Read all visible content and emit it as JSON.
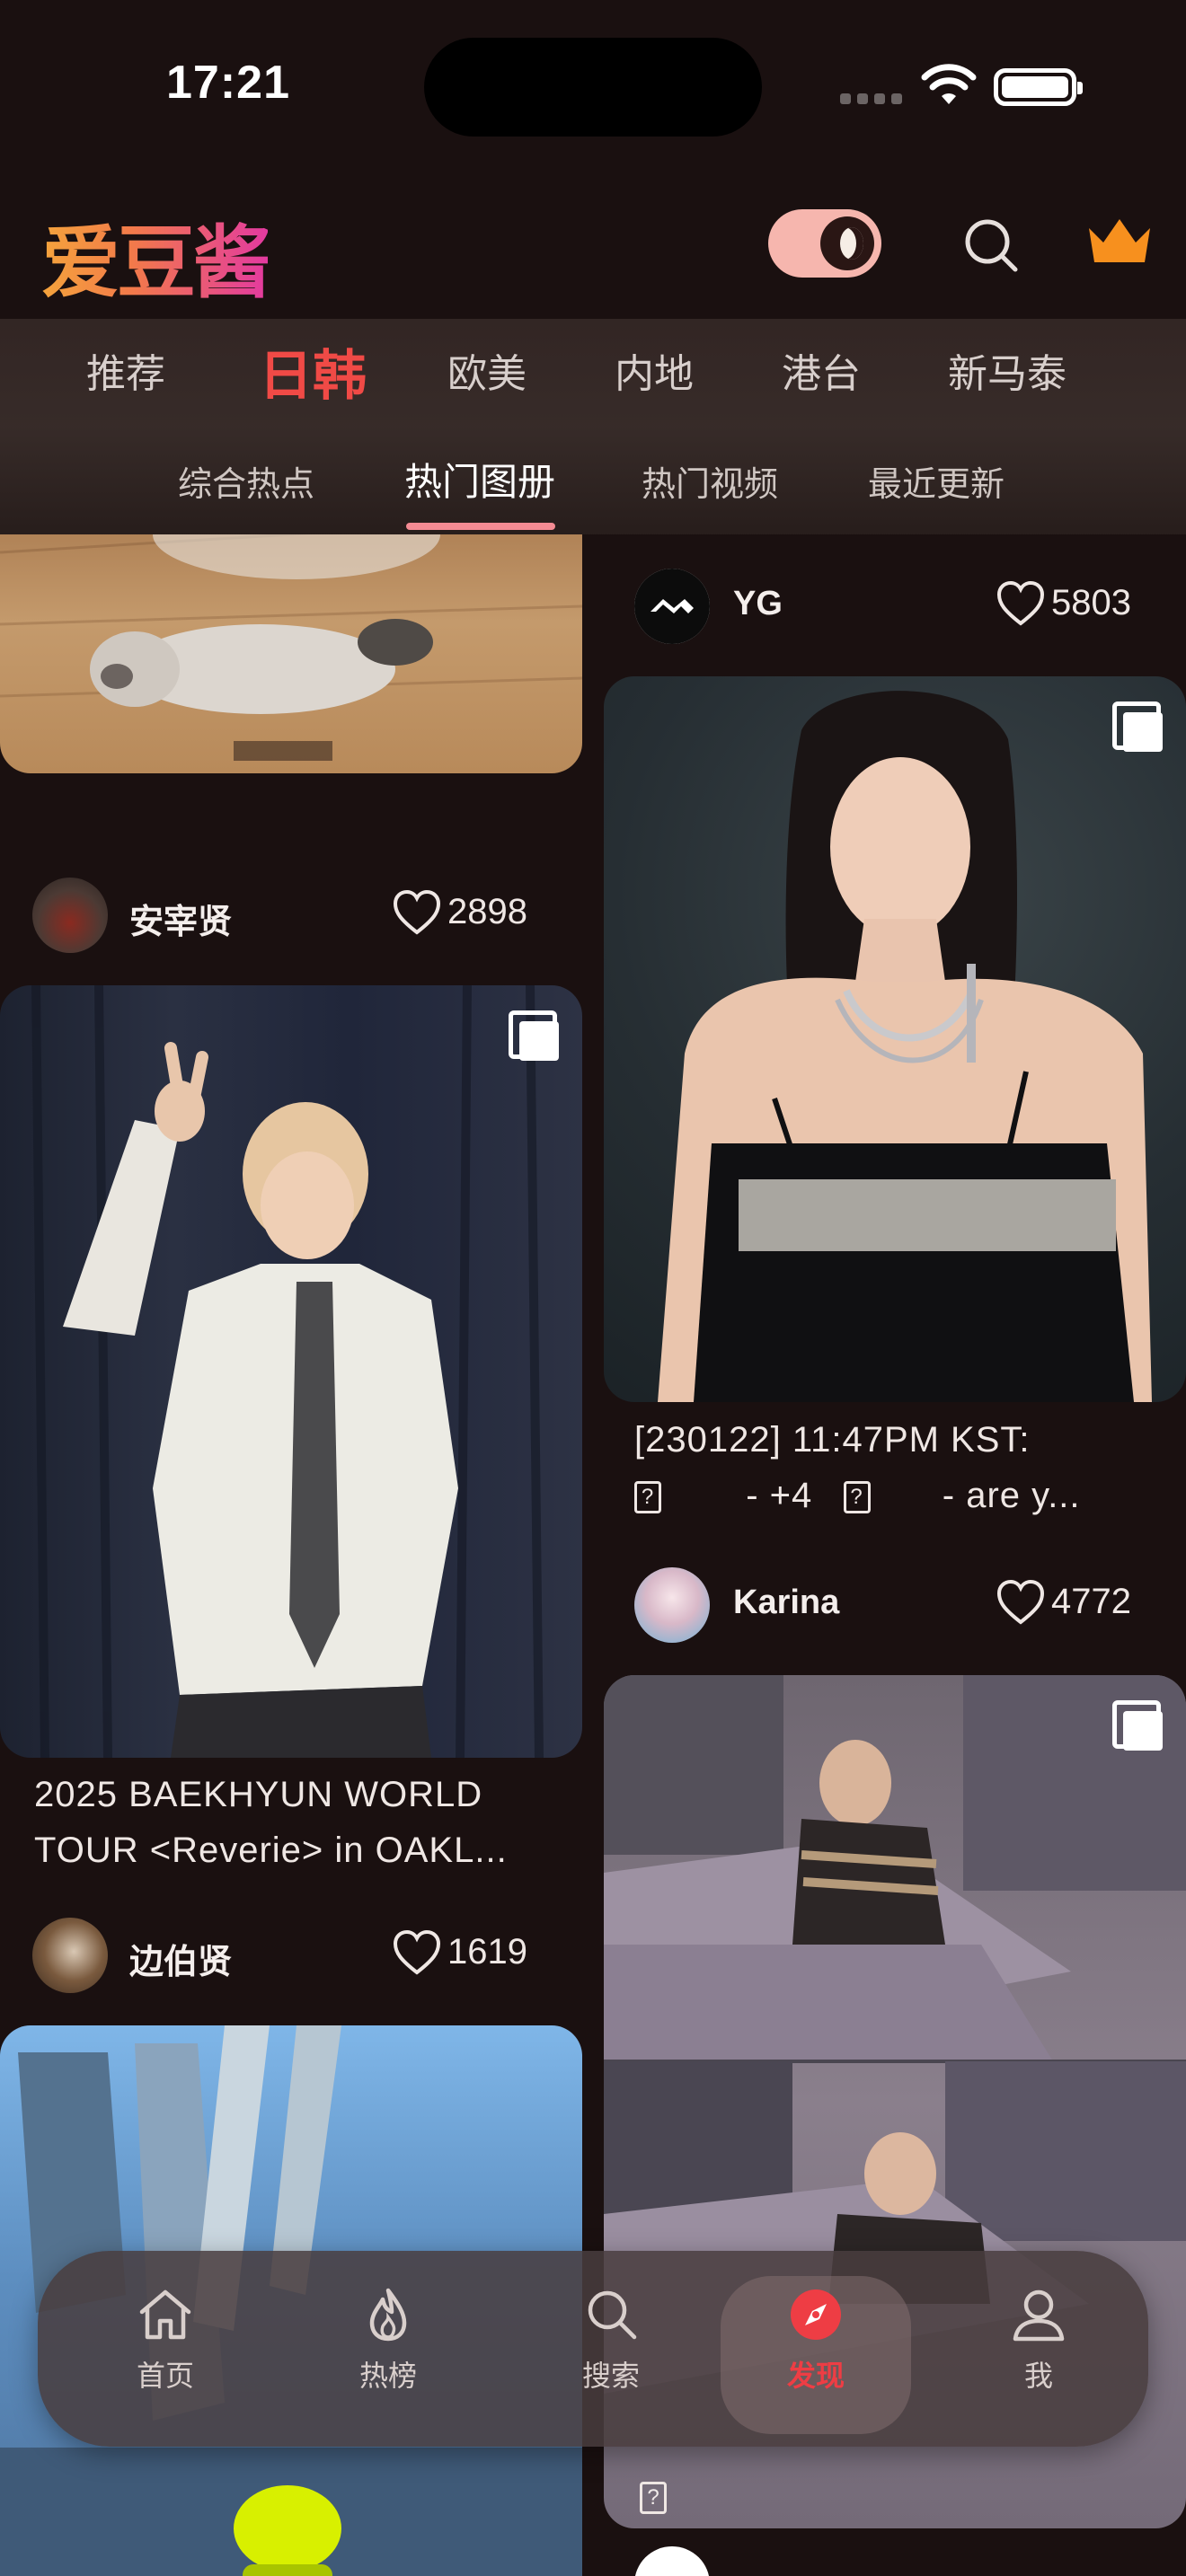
{
  "status_bar": {
    "time": "17:21"
  },
  "header": {
    "logo": "爱豆酱",
    "icons": {
      "theme_toggle": "moon-toggle-icon",
      "search": "search-icon",
      "vip": "crown-icon"
    },
    "accent": "#f04a46"
  },
  "category_tabs": [
    "推荐",
    "日韩",
    "欧美",
    "内地",
    "港台",
    "新马泰"
  ],
  "active_category": "日韩",
  "sub_tabs": [
    "综合热点",
    "热门图册",
    "热门视频",
    "最近更新"
  ],
  "active_sub_tab": "热门图册",
  "feed": {
    "left": [
      {
        "author": "安宰贤",
        "likes": "2898"
      },
      {
        "caption_line1": "2025 BAEKHYUN WORLD",
        "caption_line2": "TOUR <Reverie> in OAKL...",
        "author": "边伯贤",
        "likes": "1619"
      }
    ],
    "right": [
      {
        "author": "YG",
        "likes": "5803"
      },
      {
        "caption_line1": "[230122] 11:47PM KST:",
        "caption_line2_a": "- +4",
        "caption_line2_b": "- are y...",
        "author": "Karina",
        "likes": "4772"
      },
      {
        "caption_box": "?"
      }
    ]
  },
  "bottom_nav": [
    {
      "label": "首页",
      "icon": "home-icon"
    },
    {
      "label": "热榜",
      "icon": "flame-icon"
    },
    {
      "label": "搜索",
      "icon": "search-icon"
    },
    {
      "label": "发现",
      "icon": "compass-icon"
    },
    {
      "label": "我",
      "icon": "user-icon"
    }
  ],
  "active_nav": "发现"
}
